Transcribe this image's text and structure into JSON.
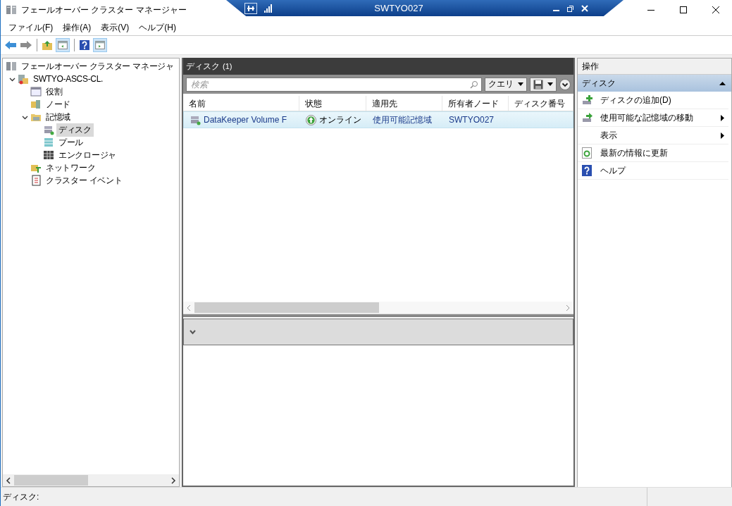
{
  "window": {
    "title": "フェールオーバー クラスター マネージャー"
  },
  "remote_bar": {
    "title": "SWTYO027"
  },
  "menu": [
    "ファイル(F)",
    "操作(A)",
    "表示(V)",
    "ヘルプ(H)"
  ],
  "tree": [
    {
      "label": "フェールオーバー クラスター マネージャ",
      "kind": "manager",
      "selected": false,
      "children": [
        {
          "label": "SWTYO-ASCS-CL.",
          "kind": "cluster",
          "selected": false,
          "expanded": true,
          "children": [
            {
              "label": "役割",
              "kind": "roles",
              "selected": false
            },
            {
              "label": "ノード",
              "kind": "nodes",
              "selected": false
            },
            {
              "label": "記憶域",
              "kind": "folder",
              "selected": false,
              "expanded": true,
              "children": [
                {
                  "label": "ディスク",
                  "kind": "disks",
                  "selected": true
                },
                {
                  "label": "プール",
                  "kind": "pools",
                  "selected": false
                },
                {
                  "label": "エンクロージャ",
                  "kind": "enclosures",
                  "selected": false
                }
              ]
            },
            {
              "label": "ネットワーク",
              "kind": "networks",
              "selected": false
            },
            {
              "label": "クラスター イベント",
              "kind": "events",
              "selected": false
            }
          ]
        }
      ]
    }
  ],
  "center": {
    "title": "ディスク",
    "count": "(1)",
    "search": {
      "placeholder": "検索"
    },
    "query_button": "クエリ",
    "table": {
      "columns": [
        "名前",
        "状態",
        "適用先",
        "所有者ノード",
        "ディスク番号"
      ],
      "rows": [
        {
          "name": "DataKeeper Volume F",
          "status": "オンライン",
          "assigned_to": "使用可能記憶域",
          "owner_node": "SWTYO027",
          "selected": true
        }
      ]
    }
  },
  "actions": {
    "title": "操作",
    "section": {
      "label": "ディスク",
      "expanded": true
    },
    "items": [
      {
        "label": "ディスクの追加(D)",
        "kind": "add",
        "submenu": false
      },
      {
        "label": "使用可能な記憶域の移動",
        "kind": "move",
        "submenu": true
      },
      {
        "label": "表示",
        "kind": "plain",
        "submenu": true
      },
      {
        "label": "最新の情報に更新",
        "kind": "refresh",
        "submenu": false
      },
      {
        "label": "ヘルプ",
        "kind": "help",
        "submenu": false
      }
    ]
  },
  "status_bar": {
    "text": "ディスク:"
  }
}
